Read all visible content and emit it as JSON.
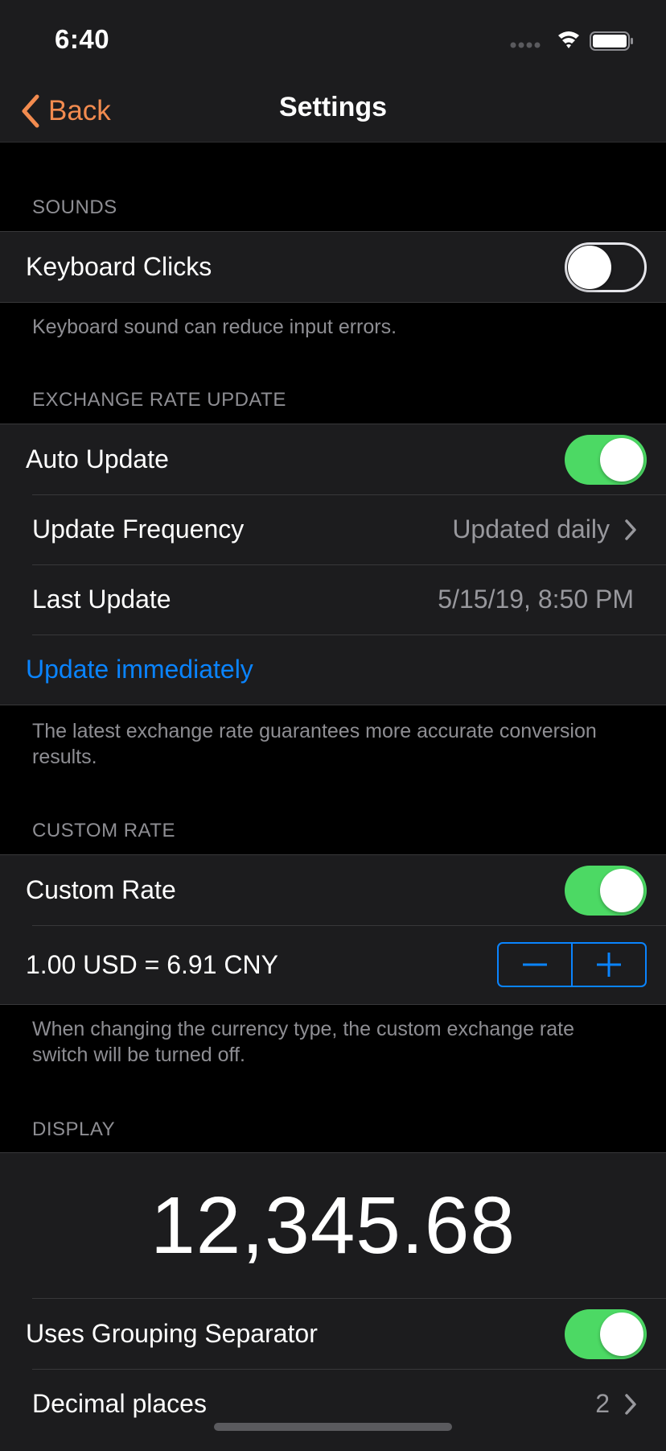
{
  "status": {
    "time": "6:40"
  },
  "nav": {
    "back_label": "Back",
    "title": "Settings"
  },
  "sounds": {
    "header": "SOUNDS",
    "keyboard_clicks_label": "Keyboard Clicks",
    "keyboard_clicks_on": false,
    "footer": "Keyboard sound can reduce input errors."
  },
  "exchange": {
    "header": "EXCHANGE RATE UPDATE",
    "auto_update_label": "Auto Update",
    "auto_update_on": true,
    "frequency_label": "Update Frequency",
    "frequency_value": "Updated daily",
    "last_update_label": "Last Update",
    "last_update_value": "5/15/19, 8:50 PM",
    "update_now_label": "Update immediately",
    "footer": "The latest exchange rate guarantees more accurate conversion results."
  },
  "custom_rate": {
    "header": "CUSTOM RATE",
    "toggle_label": "Custom Rate",
    "toggle_on": true,
    "rate_text": "1.00 USD = 6.91 CNY",
    "footer": "When changing the currency type, the custom exchange rate switch will be turned off."
  },
  "display": {
    "header": "DISPLAY",
    "preview_number": "12,345.68",
    "grouping_label": "Uses Grouping Separator",
    "grouping_on": true,
    "decimal_label": "Decimal places",
    "decimal_value": "2"
  },
  "colors": {
    "accent_orange": "#f28b4f",
    "link_blue": "#0a84ff",
    "toggle_green": "#4cd964",
    "background": "#000000",
    "cell": "#1c1c1e"
  }
}
